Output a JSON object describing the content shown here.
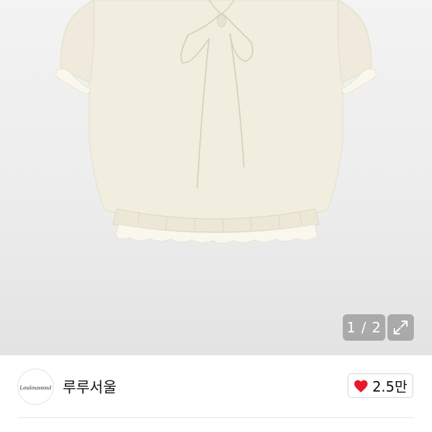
{
  "gallery": {
    "page_counter": "1 / 2",
    "expand_icon": "expand-arrows-icon"
  },
  "shop": {
    "name": "루루서울",
    "logo_text": "Louloussoul",
    "like_icon": "heart-icon",
    "like_color": "#e8192c",
    "like_count": "2.5만"
  }
}
